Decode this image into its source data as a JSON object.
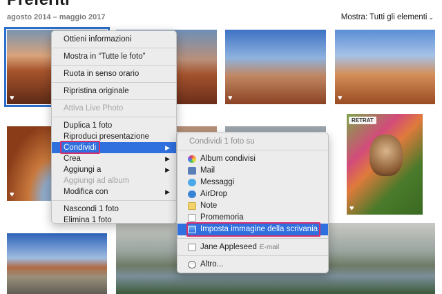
{
  "header": {
    "title": "Preferiti",
    "date_range": "agosto 2014 – maggio 2017",
    "show_label": "Mostra:",
    "show_value": "Tutti gli elementi"
  },
  "photos": {
    "retrat_badge": "RETRAT"
  },
  "context_menu": {
    "items": [
      {
        "label": "Ottieni informazioni"
      },
      {
        "label": "Mostra in “Tutte le foto”"
      },
      {
        "label": "Ruota in senso orario"
      },
      {
        "label": "Ripristina originale"
      },
      {
        "label": "Attiva Live Photo"
      },
      {
        "label": "Duplica 1 foto"
      },
      {
        "label": "Riproduci presentazione"
      },
      {
        "label": "Condividi"
      },
      {
        "label": "Crea"
      },
      {
        "label": "Aggiungi a"
      },
      {
        "label": "Aggiungi ad album"
      },
      {
        "label": "Modifica con"
      },
      {
        "label": "Nascondi 1 foto"
      },
      {
        "label": "Elimina 1 foto"
      }
    ]
  },
  "share_menu": {
    "header": "Condividi 1 foto su",
    "items": [
      {
        "label": "Album condivisi",
        "icon": "shared-albums-icon"
      },
      {
        "label": "Mail",
        "icon": "mail-icon"
      },
      {
        "label": "Messaggi",
        "icon": "messages-icon"
      },
      {
        "label": "AirDrop",
        "icon": "airdrop-icon"
      },
      {
        "label": "Note",
        "icon": "notes-icon"
      },
      {
        "label": "Promemoria",
        "icon": "reminders-icon"
      },
      {
        "label": "Imposta immagine della scrivania",
        "icon": "desktop-picture-icon"
      },
      {
        "label": "Jane Appleseed",
        "sublabel": "E-mail",
        "icon": "envelope-icon"
      },
      {
        "label": "Altro...",
        "icon": "more-icon"
      }
    ]
  },
  "colors": {
    "selection": "#2f6fde",
    "highlight": "#d62f6d"
  }
}
